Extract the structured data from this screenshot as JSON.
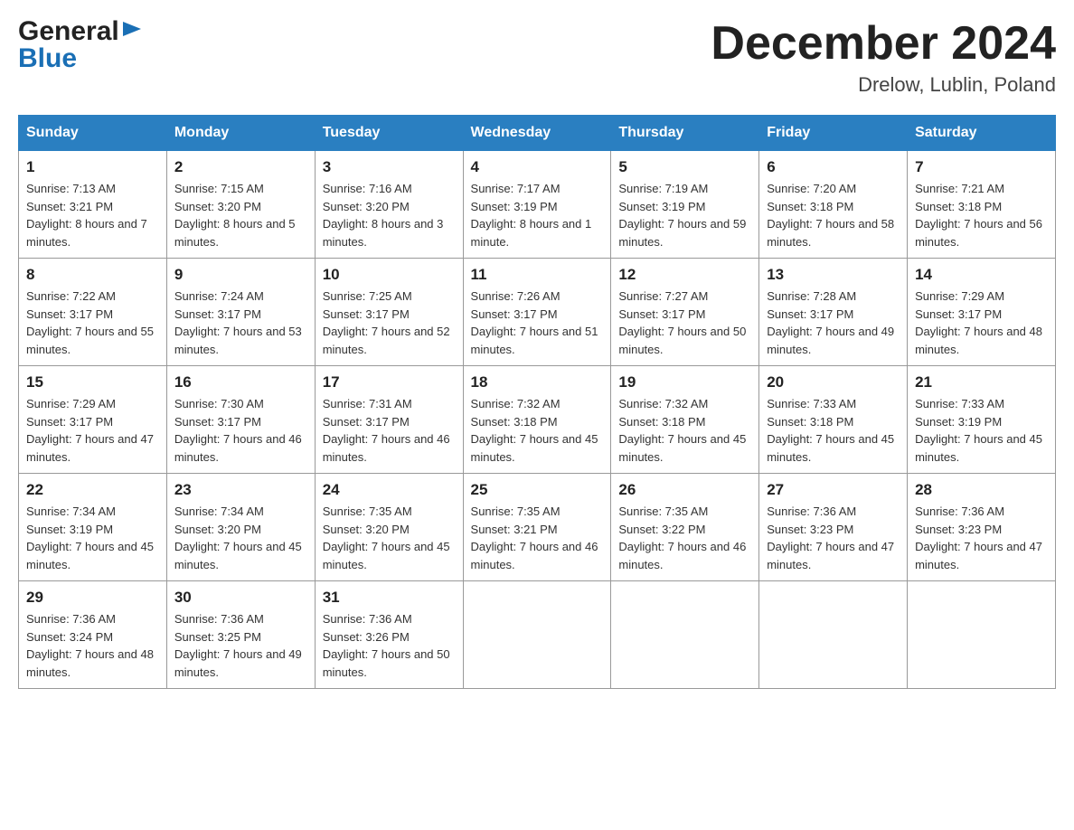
{
  "header": {
    "logo_general": "General",
    "logo_blue": "Blue",
    "month_title": "December 2024",
    "location": "Drelow, Lublin, Poland"
  },
  "days_of_week": [
    "Sunday",
    "Monday",
    "Tuesday",
    "Wednesday",
    "Thursday",
    "Friday",
    "Saturday"
  ],
  "weeks": [
    [
      {
        "day": "1",
        "sunrise": "Sunrise: 7:13 AM",
        "sunset": "Sunset: 3:21 PM",
        "daylight": "Daylight: 8 hours and 7 minutes."
      },
      {
        "day": "2",
        "sunrise": "Sunrise: 7:15 AM",
        "sunset": "Sunset: 3:20 PM",
        "daylight": "Daylight: 8 hours and 5 minutes."
      },
      {
        "day": "3",
        "sunrise": "Sunrise: 7:16 AM",
        "sunset": "Sunset: 3:20 PM",
        "daylight": "Daylight: 8 hours and 3 minutes."
      },
      {
        "day": "4",
        "sunrise": "Sunrise: 7:17 AM",
        "sunset": "Sunset: 3:19 PM",
        "daylight": "Daylight: 8 hours and 1 minute."
      },
      {
        "day": "5",
        "sunrise": "Sunrise: 7:19 AM",
        "sunset": "Sunset: 3:19 PM",
        "daylight": "Daylight: 7 hours and 59 minutes."
      },
      {
        "day": "6",
        "sunrise": "Sunrise: 7:20 AM",
        "sunset": "Sunset: 3:18 PM",
        "daylight": "Daylight: 7 hours and 58 minutes."
      },
      {
        "day": "7",
        "sunrise": "Sunrise: 7:21 AM",
        "sunset": "Sunset: 3:18 PM",
        "daylight": "Daylight: 7 hours and 56 minutes."
      }
    ],
    [
      {
        "day": "8",
        "sunrise": "Sunrise: 7:22 AM",
        "sunset": "Sunset: 3:17 PM",
        "daylight": "Daylight: 7 hours and 55 minutes."
      },
      {
        "day": "9",
        "sunrise": "Sunrise: 7:24 AM",
        "sunset": "Sunset: 3:17 PM",
        "daylight": "Daylight: 7 hours and 53 minutes."
      },
      {
        "day": "10",
        "sunrise": "Sunrise: 7:25 AM",
        "sunset": "Sunset: 3:17 PM",
        "daylight": "Daylight: 7 hours and 52 minutes."
      },
      {
        "day": "11",
        "sunrise": "Sunrise: 7:26 AM",
        "sunset": "Sunset: 3:17 PM",
        "daylight": "Daylight: 7 hours and 51 minutes."
      },
      {
        "day": "12",
        "sunrise": "Sunrise: 7:27 AM",
        "sunset": "Sunset: 3:17 PM",
        "daylight": "Daylight: 7 hours and 50 minutes."
      },
      {
        "day": "13",
        "sunrise": "Sunrise: 7:28 AM",
        "sunset": "Sunset: 3:17 PM",
        "daylight": "Daylight: 7 hours and 49 minutes."
      },
      {
        "day": "14",
        "sunrise": "Sunrise: 7:29 AM",
        "sunset": "Sunset: 3:17 PM",
        "daylight": "Daylight: 7 hours and 48 minutes."
      }
    ],
    [
      {
        "day": "15",
        "sunrise": "Sunrise: 7:29 AM",
        "sunset": "Sunset: 3:17 PM",
        "daylight": "Daylight: 7 hours and 47 minutes."
      },
      {
        "day": "16",
        "sunrise": "Sunrise: 7:30 AM",
        "sunset": "Sunset: 3:17 PM",
        "daylight": "Daylight: 7 hours and 46 minutes."
      },
      {
        "day": "17",
        "sunrise": "Sunrise: 7:31 AM",
        "sunset": "Sunset: 3:17 PM",
        "daylight": "Daylight: 7 hours and 46 minutes."
      },
      {
        "day": "18",
        "sunrise": "Sunrise: 7:32 AM",
        "sunset": "Sunset: 3:18 PM",
        "daylight": "Daylight: 7 hours and 45 minutes."
      },
      {
        "day": "19",
        "sunrise": "Sunrise: 7:32 AM",
        "sunset": "Sunset: 3:18 PM",
        "daylight": "Daylight: 7 hours and 45 minutes."
      },
      {
        "day": "20",
        "sunrise": "Sunrise: 7:33 AM",
        "sunset": "Sunset: 3:18 PM",
        "daylight": "Daylight: 7 hours and 45 minutes."
      },
      {
        "day": "21",
        "sunrise": "Sunrise: 7:33 AM",
        "sunset": "Sunset: 3:19 PM",
        "daylight": "Daylight: 7 hours and 45 minutes."
      }
    ],
    [
      {
        "day": "22",
        "sunrise": "Sunrise: 7:34 AM",
        "sunset": "Sunset: 3:19 PM",
        "daylight": "Daylight: 7 hours and 45 minutes."
      },
      {
        "day": "23",
        "sunrise": "Sunrise: 7:34 AM",
        "sunset": "Sunset: 3:20 PM",
        "daylight": "Daylight: 7 hours and 45 minutes."
      },
      {
        "day": "24",
        "sunrise": "Sunrise: 7:35 AM",
        "sunset": "Sunset: 3:20 PM",
        "daylight": "Daylight: 7 hours and 45 minutes."
      },
      {
        "day": "25",
        "sunrise": "Sunrise: 7:35 AM",
        "sunset": "Sunset: 3:21 PM",
        "daylight": "Daylight: 7 hours and 46 minutes."
      },
      {
        "day": "26",
        "sunrise": "Sunrise: 7:35 AM",
        "sunset": "Sunset: 3:22 PM",
        "daylight": "Daylight: 7 hours and 46 minutes."
      },
      {
        "day": "27",
        "sunrise": "Sunrise: 7:36 AM",
        "sunset": "Sunset: 3:23 PM",
        "daylight": "Daylight: 7 hours and 47 minutes."
      },
      {
        "day": "28",
        "sunrise": "Sunrise: 7:36 AM",
        "sunset": "Sunset: 3:23 PM",
        "daylight": "Daylight: 7 hours and 47 minutes."
      }
    ],
    [
      {
        "day": "29",
        "sunrise": "Sunrise: 7:36 AM",
        "sunset": "Sunset: 3:24 PM",
        "daylight": "Daylight: 7 hours and 48 minutes."
      },
      {
        "day": "30",
        "sunrise": "Sunrise: 7:36 AM",
        "sunset": "Sunset: 3:25 PM",
        "daylight": "Daylight: 7 hours and 49 minutes."
      },
      {
        "day": "31",
        "sunrise": "Sunrise: 7:36 AM",
        "sunset": "Sunset: 3:26 PM",
        "daylight": "Daylight: 7 hours and 50 minutes."
      },
      null,
      null,
      null,
      null
    ]
  ]
}
